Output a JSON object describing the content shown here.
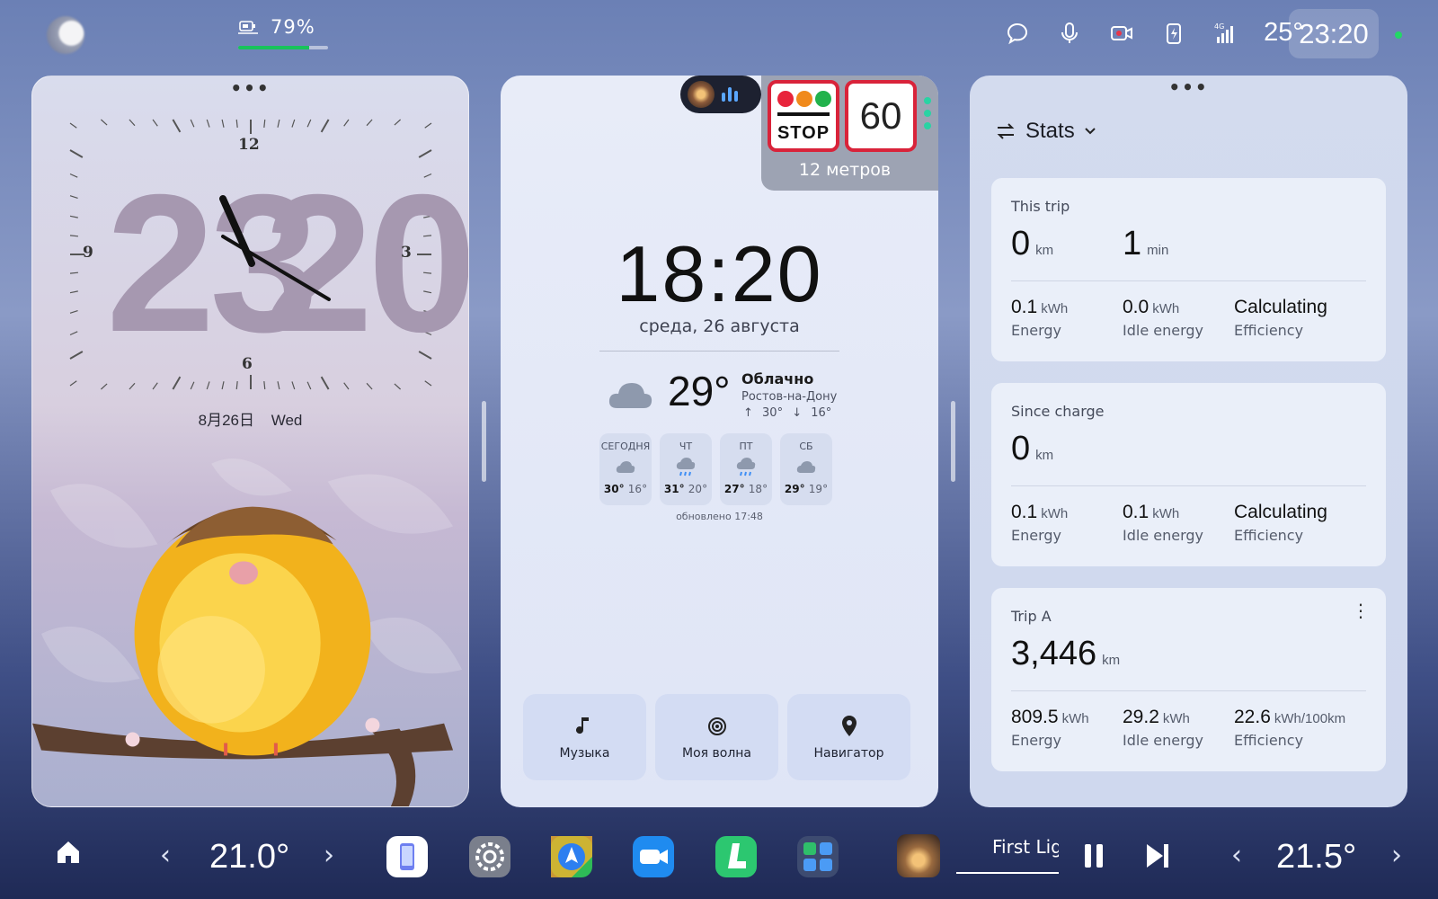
{
  "status_bar": {
    "battery_percent": "79%",
    "battery_level": 0.79,
    "temperature": "25°",
    "time": "23:20",
    "icons": [
      "chat-icon",
      "microphone-icon",
      "camera-icon",
      "charging-icon",
      "signal-4g-icon"
    ],
    "signal_label": "4G"
  },
  "clock_widget": {
    "hours": "23",
    "minutes": "20",
    "dial_12": "12",
    "dial_3": "3",
    "dial_6": "6",
    "dial_9": "9",
    "date": "8月26日",
    "weekday": "Wed"
  },
  "traffic": {
    "stop_label": "STOP",
    "speed_limit": "60",
    "distance": "12 метров"
  },
  "time_widget": {
    "time": "18:20",
    "date": "среда, 26 августа"
  },
  "weather": {
    "temperature": "29°",
    "condition": "Облачно",
    "city": "Ростов-на-Дону",
    "high": "↑ 30°",
    "low": "↓ 16°",
    "forecast": [
      {
        "day": "СЕГОДНЯ",
        "high": "30°",
        "low": "16°",
        "icon": "cloud-icon"
      },
      {
        "day": "ЧТ",
        "high": "31°",
        "low": "20°",
        "icon": "rain-cloud-icon"
      },
      {
        "day": "ПТ",
        "high": "27°",
        "low": "18°",
        "icon": "rain-cloud-icon"
      },
      {
        "day": "СБ",
        "high": "29°",
        "low": "19°",
        "icon": "cloud-icon"
      }
    ],
    "updated": "обновлено 17:48"
  },
  "quick_actions": [
    {
      "label": "Музыка",
      "icon": "music-note-icon"
    },
    {
      "label": "Моя волна",
      "icon": "wave-icon"
    },
    {
      "label": "Навигатор",
      "icon": "location-pin-icon"
    }
  ],
  "stats": {
    "header": "Stats",
    "this_trip": {
      "title": "This trip",
      "distance": "0",
      "distance_unit": "km",
      "duration": "1",
      "duration_unit": "min",
      "energy": "0.1",
      "energy_unit": "kWh",
      "energy_label": "Energy",
      "idle": "0.0",
      "idle_unit": "kWh",
      "idle_label": "Idle energy",
      "efficiency": "Calculating",
      "efficiency_label": "Efficiency"
    },
    "since_charge": {
      "title": "Since charge",
      "distance": "0",
      "distance_unit": "km",
      "energy": "0.1",
      "energy_unit": "kWh",
      "energy_label": "Energy",
      "idle": "0.1",
      "idle_unit": "kWh",
      "idle_label": "Idle energy",
      "efficiency": "Calculating",
      "efficiency_label": "Efficiency"
    },
    "trip_a": {
      "title": "Trip A",
      "distance": "3,446",
      "distance_unit": "km",
      "energy": "809.5",
      "energy_unit": "kWh",
      "energy_label": "Energy",
      "idle": "29.2",
      "idle_unit": "kWh",
      "idle_label": "Idle energy",
      "efficiency": "22.6",
      "efficiency_unit": "kWh/100km",
      "efficiency_label": "Efficiency"
    }
  },
  "dock": {
    "left_temp": "21.0°",
    "right_temp": "21.5°",
    "song": "First Lig",
    "apps": [
      "phone-app-icon",
      "settings-app-icon",
      "navigation-app-icon",
      "video-call-app-icon",
      "seat-app-icon",
      "controls-app-icon"
    ]
  },
  "colors": {
    "accent_green": "#18c35b",
    "stop_red": "#d9233a",
    "signal_green": "#29d3a3"
  }
}
